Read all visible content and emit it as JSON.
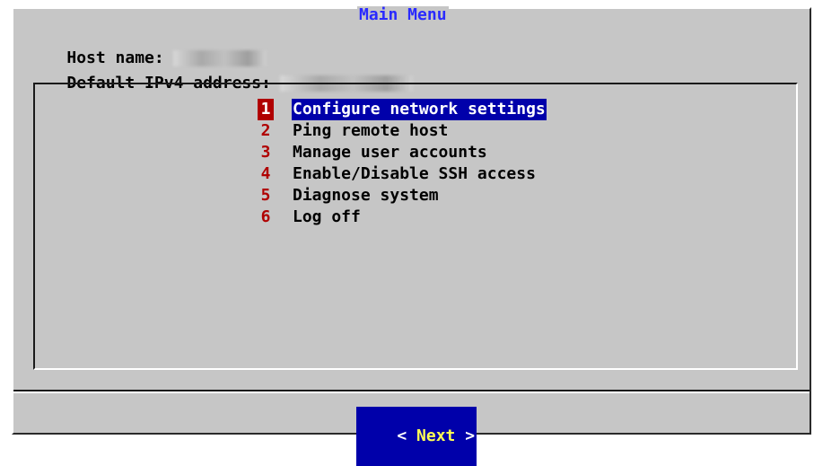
{
  "dialog": {
    "title": "Main Menu"
  },
  "host": {
    "label": "Host name:",
    "value_redacted": true
  },
  "ipv4": {
    "label": "Default IPv4 address:",
    "value_redacted": true
  },
  "menu": {
    "selected_index": 0,
    "items": [
      {
        "key": "1",
        "label": "Configure network settings"
      },
      {
        "key": "2",
        "label": "Ping remote host"
      },
      {
        "key": "3",
        "label": "Manage user accounts"
      },
      {
        "key": "4",
        "label": "Enable/Disable SSH access"
      },
      {
        "key": "5",
        "label": "Diagnose system"
      },
      {
        "key": "6",
        "label": "Log off"
      }
    ]
  },
  "buttons": {
    "next": {
      "left_bracket": "<",
      "label": "Next",
      "right_bracket": ">"
    }
  },
  "colors": {
    "background": "#c6c6c6",
    "title": "#2a2aff",
    "selection": "#0000aa",
    "hotkey": "#b00000",
    "button_label": "#ffff55"
  }
}
